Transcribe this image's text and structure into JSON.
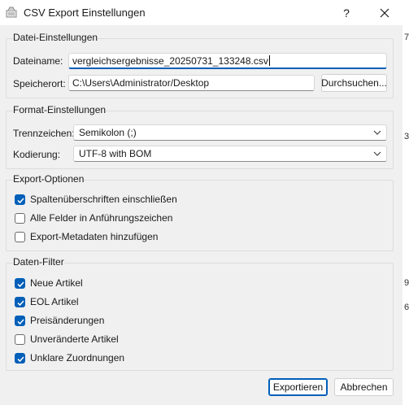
{
  "window": {
    "title": "CSV Export Einstellungen",
    "help_glyph": "?",
    "close_glyph": "✕"
  },
  "file_settings": {
    "title": "Datei-Einstellungen",
    "filename_label": "Dateiname:",
    "filename_value": "vergleichsergebnisse_20250731_133248.csv",
    "location_label": "Speicherort:",
    "location_value": "C:\\Users\\Administrator/Desktop",
    "browse_label": "Durchsuchen..."
  },
  "format_settings": {
    "title": "Format-Einstellungen",
    "separator_label": "Trennzeichen:",
    "separator_value": "Semikolon (;)",
    "encoding_label": "Kodierung:",
    "encoding_value": "UTF-8 with BOM"
  },
  "export_options": {
    "title": "Export-Optionen",
    "items": [
      {
        "label": "Spaltenüberschriften einschließen",
        "checked": true
      },
      {
        "label": "Alle Felder in Anführungszeichen",
        "checked": false
      },
      {
        "label": "Export-Metadaten hinzufügen",
        "checked": false
      }
    ]
  },
  "data_filter": {
    "title": "Daten-Filter",
    "items": [
      {
        "label": "Neue Artikel",
        "checked": true
      },
      {
        "label": "EOL Artikel",
        "checked": true
      },
      {
        "label": "Preisänderungen",
        "checked": true
      },
      {
        "label": "Unveränderte Artikel",
        "checked": false
      },
      {
        "label": "Unklare Zuordnungen",
        "checked": true
      }
    ]
  },
  "footer": {
    "export_label": "Exportieren",
    "cancel_label": "Abbrechen"
  },
  "background_chars": [
    "7",
    "3",
    "9",
    "6"
  ],
  "colors": {
    "accent": "#005fb8",
    "dialog_bg": "#f0f0f0"
  }
}
